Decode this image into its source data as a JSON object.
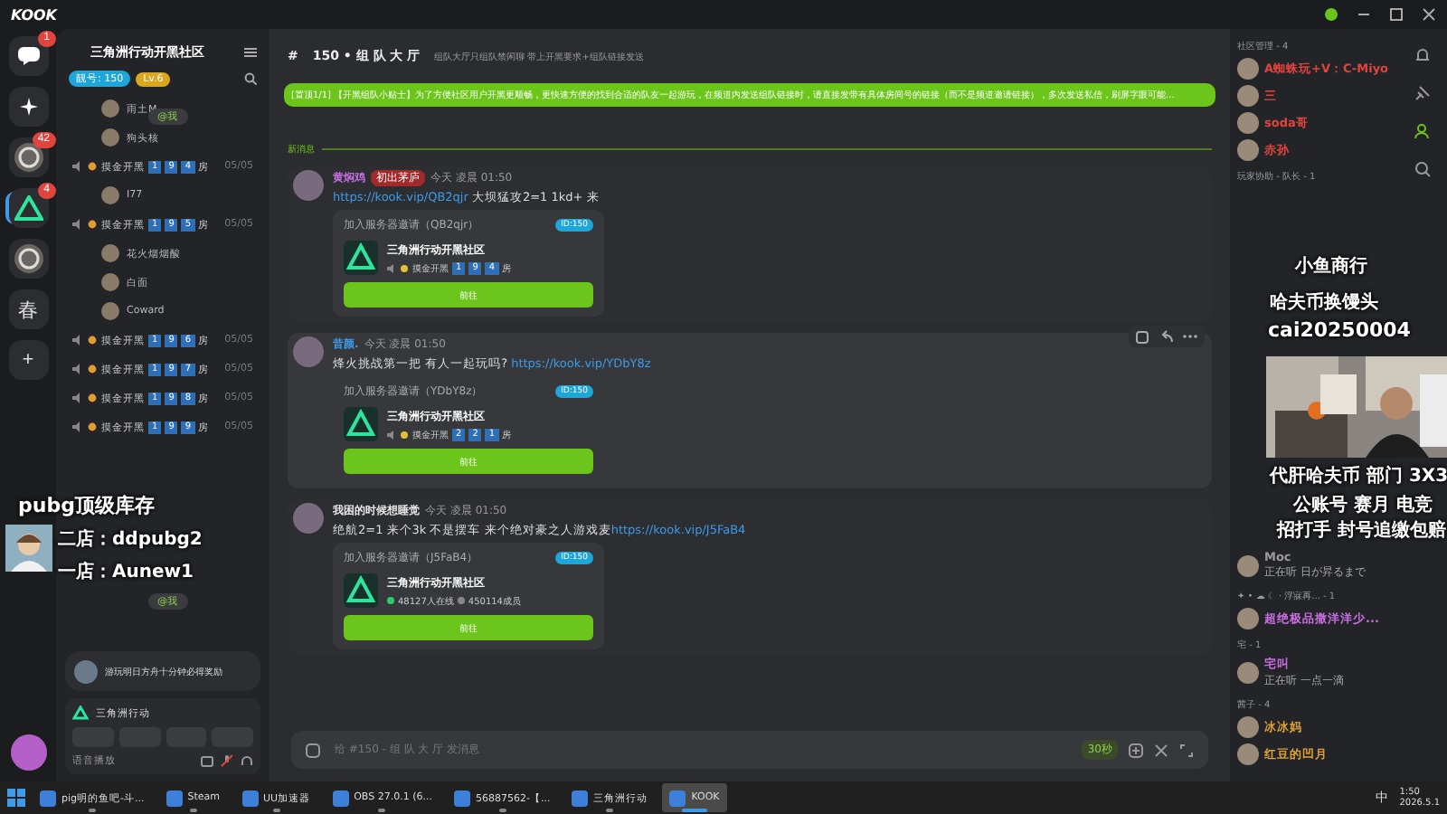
{
  "app": {
    "logo": "KOOK"
  },
  "servers": [
    {
      "kind": "dm",
      "badge": "1",
      "selected": false
    },
    {
      "kind": "discover",
      "selected": false
    },
    {
      "kind": "avatar",
      "badge": "42",
      "selected": false
    },
    {
      "kind": "logo",
      "badge": "4",
      "selected": true
    },
    {
      "kind": "avatar",
      "selected": false
    },
    {
      "kind": "text",
      "label": "春",
      "selected": false
    },
    {
      "kind": "add",
      "label": "+",
      "selected": false
    }
  ],
  "channel_panel": {
    "title": "三角洲行动开黑社区",
    "badges": [
      {
        "text": "靓号: 150",
        "color": "#1fa6d9"
      },
      {
        "text": "Lv.6",
        "color": "#d9a61f"
      }
    ],
    "items": [
      {
        "kind": "user",
        "name": "雨土M"
      },
      {
        "kind": "user",
        "name": "狗头核"
      },
      {
        "kind": "room",
        "label": "摸金开黑",
        "digits": [
          "1",
          "9",
          "4"
        ],
        "suffix": "房",
        "count": "05/05"
      },
      {
        "kind": "user",
        "name": "I77"
      },
      {
        "kind": "room",
        "label": "摸金开黑",
        "digits": [
          "1",
          "9",
          "5"
        ],
        "suffix": "房",
        "count": "05/05"
      },
      {
        "kind": "user",
        "name": "花火烟烟酸"
      },
      {
        "kind": "user",
        "name": "白面"
      },
      {
        "kind": "user",
        "name": "Coward"
      },
      {
        "kind": "room",
        "label": "摸金开黑",
        "digits": [
          "1",
          "9",
          "6"
        ],
        "suffix": "房",
        "count": "05/05"
      },
      {
        "kind": "room",
        "label": "摸金开黑",
        "digits": [
          "1",
          "9",
          "7"
        ],
        "suffix": "房",
        "count": "05/05"
      },
      {
        "kind": "room",
        "label": "摸金开黑",
        "digits": [
          "1",
          "9",
          "8"
        ],
        "suffix": "房",
        "count": "05/05"
      },
      {
        "kind": "room",
        "label": "摸金开黑",
        "digits": [
          "1",
          "9",
          "9"
        ],
        "suffix": "房",
        "count": "05/05"
      }
    ],
    "mentions": [
      "@我",
      "@我"
    ],
    "promo": {
      "title": "游玩明日方舟十分钟必得奖励"
    },
    "voice": {
      "server": "三角洲行动",
      "status": "语音播放"
    }
  },
  "channel": {
    "hash": "#",
    "name": "150 • 组 队 大 厅",
    "topic": "组队大厅只组队禁闲聊 带上开黑要求+组队链接发送",
    "pinned": "[置顶1/1] 【开黑组队小贴士】为了方便社区用户开黑更顺畅，更快速方便的找到合适的队友一起游玩，在频道内发送组队链接时，请直接发带有具体房间号的链接（而不是频道邀请链接），多次发送私信，刷屏字眼可能...",
    "divider": "新消息",
    "messages": [
      {
        "author": "黄焖鸡",
        "color": "#c86ee0",
        "badge": "初出茅庐",
        "time": "今天 凌晨 01:50",
        "hovered": false,
        "parts": [
          {
            "kind": "link",
            "text": "https://kook.vip/QB2qjr"
          },
          {
            "kind": "text",
            "text": " 大坝猛攻2=1 1kd+ 来"
          }
        ],
        "card": {
          "title": "加入服务器邀请（QB2qjr）",
          "id": "ID:150",
          "server": "三角洲行动开黑社区",
          "kind": "room",
          "label": "摸金开黑",
          "digits": [
            "1",
            "9",
            "4"
          ],
          "suffix": "房",
          "button": "前往"
        }
      },
      {
        "author": "昔颜.",
        "color": "#3d9be9",
        "time": "今天 凌晨 01:50",
        "hovered": true,
        "parts": [
          {
            "kind": "text",
            "text": "烽火挑战第一把 有人一起玩吗? "
          },
          {
            "kind": "link",
            "text": "https://kook.vip/YDbY8z"
          }
        ],
        "card": {
          "title": "加入服务器邀请（YDbY8z）",
          "id": "ID:150",
          "server": "三角洲行动开黑社区",
          "kind": "room",
          "label": "摸金开黑",
          "digits": [
            "2",
            "2",
            "1"
          ],
          "suffix": "房",
          "button": "前往"
        }
      },
      {
        "author": "我困的时候想睡觉",
        "color": "#e8e8e8",
        "time": "今天 凌晨 01:50",
        "hovered": false,
        "parts": [
          {
            "kind": "text",
            "text": "绝航2=1 来个3k 不是摆车 来个绝对豪之人游戏麦"
          },
          {
            "kind": "link",
            "text": "https://kook.vip/J5FaB4"
          }
        ],
        "card": {
          "title": "加入服务器邀请（J5FaB4）",
          "id": "ID:150",
          "server": "三角洲行动开黑社区",
          "kind": "stats",
          "online": "48127人在线",
          "members": "450114成员",
          "button": "前往"
        }
      }
    ],
    "input": {
      "placeholder": "给 #150 - 组 队 大 厅 发消息",
      "slowmode": "30秒"
    }
  },
  "members": {
    "top": [
      {
        "title": "社区管理 - 4",
        "items": [
          {
            "name": "A蜘蛛玩+V：C-Miyo",
            "color": "#e0443e"
          },
          {
            "name": "三",
            "color": "#e0443e"
          },
          {
            "name": "soda哥",
            "color": "#e0443e"
          },
          {
            "name": "赤孙",
            "color": "#e0443e"
          }
        ]
      },
      {
        "title": "玩家协助 - 队长 - 1"
      }
    ],
    "bottom": [
      {
        "items": [
          {
            "name": "Moc",
            "color": "#9a9a9a",
            "status": "正在听 日が昇るまで"
          }
        ]
      },
      {
        "title": "✦ • ☁ ☾ · 浮寐再... - 1",
        "items": [
          {
            "name": "超绝极品撒洋洋少...",
            "color": "#c86ee0"
          }
        ]
      },
      {
        "title": "宅 - 1",
        "items": [
          {
            "name": "宅叫",
            "color": "#c86ee0",
            "status": "正在听 一点一滴"
          }
        ]
      },
      {
        "title": "茜子 - 4",
        "items": [
          {
            "name": "冰冰妈",
            "color": "#e0a030"
          },
          {
            "name": "红豆的凹月",
            "color": "#e0a030"
          }
        ]
      }
    ]
  },
  "overlays": {
    "left": [
      "pubg顶级库存",
      "二店：ddpubg2",
      "一店：Aunew1"
    ],
    "right_top": [
      "小鱼商行",
      "哈夫币换馒头",
      "cai20250004"
    ],
    "right_bottom": [
      "代肝哈夫币 部门 3X3",
      "公账号 赛月 电竞",
      "招打手 封号追缴包赔"
    ]
  },
  "taskbar": {
    "apps": [
      {
        "label": "pig明的鱼吧-斗...",
        "active": false
      },
      {
        "label": "Steam",
        "active": false
      },
      {
        "label": "UU加速器",
        "active": false
      },
      {
        "label": "OBS 27.0.1 (6...",
        "active": false
      },
      {
        "label": "56887562-【...",
        "active": false
      },
      {
        "label": "三角洲行动",
        "active": false
      },
      {
        "label": "KOOK",
        "active": true
      }
    ],
    "ime": "中",
    "time": "1:50",
    "date": "2026.5.1"
  }
}
